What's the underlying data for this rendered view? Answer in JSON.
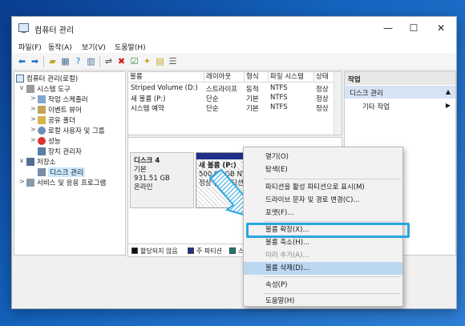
{
  "window": {
    "title": "컴퓨터 관리",
    "buttons": {
      "minimize": "—",
      "maximize": "☐",
      "close": "✕"
    }
  },
  "menu": [
    "파일(F)",
    "동작(A)",
    "보기(V)",
    "도움말(H)"
  ],
  "toolbar_icons": [
    "back-arrow-icon",
    "forward-arrow-icon",
    "up-folder-icon",
    "properties-icon",
    "help-icon",
    "show-hide-icon",
    "connect-icon",
    "delete-icon",
    "check-icon",
    "new-icon",
    "folder-icon",
    "list-icon"
  ],
  "tree": [
    {
      "label": "컴퓨터 관리(로컬)",
      "exp": "",
      "icon": "computer-icon"
    },
    {
      "label": "시스템 도구",
      "exp": "∨",
      "icon": "tools-icon"
    },
    {
      "label": "작업 스케줄러",
      "exp": ">",
      "icon": "scheduler-icon"
    },
    {
      "label": "이벤트 뷰어",
      "exp": ">",
      "icon": "event-viewer-icon"
    },
    {
      "label": "공유 폴더",
      "exp": ">",
      "icon": "shared-folder-icon"
    },
    {
      "label": "로컬 사용자 및 그룹",
      "exp": ">",
      "icon": "users-icon"
    },
    {
      "label": "성능",
      "exp": ">",
      "icon": "performance-icon"
    },
    {
      "label": "장치 관리자",
      "exp": "",
      "icon": "device-manager-icon"
    },
    {
      "label": "저장소",
      "exp": "∨",
      "icon": "storage-icon"
    },
    {
      "label": "디스크 관리",
      "exp": "",
      "icon": "disk-management-icon"
    },
    {
      "label": "서비스 및 응용 프로그램",
      "exp": ">",
      "icon": "services-icon"
    }
  ],
  "volume_columns": [
    "볼륨",
    "레이아웃",
    "형식",
    "파일 시스템",
    "상태"
  ],
  "volumes": [
    {
      "name": "Striped Volume (D:)",
      "layout": "스트라이프",
      "type": "동적",
      "fs": "NTFS",
      "status": "정상"
    },
    {
      "name": "새 볼륨 (P:)",
      "layout": "단순",
      "type": "기본",
      "fs": "NTFS",
      "status": "정상"
    },
    {
      "name": "시스템 예약",
      "layout": "단순",
      "type": "기본",
      "fs": "NTFS",
      "status": "정상"
    }
  ],
  "disk": {
    "name": "디스크 4",
    "type": "기본",
    "size": "931.51 GB",
    "state": "온라인",
    "partition": {
      "name": "새 볼륨 (P:)",
      "size": "500.00 GB NTF",
      "status": "정상 (주 파티션"
    }
  },
  "legend": [
    "할당되지 않음",
    "주 파티션",
    "스"
  ],
  "actions": {
    "header": "작업",
    "selected": "디스크 관리",
    "more": "기타 작업"
  },
  "context_menu": [
    {
      "label": "열기(O)",
      "disabled": false
    },
    {
      "label": "탐색(E)",
      "disabled": false
    },
    {
      "label": "파티션을 활성 파티션으로 표시(M)",
      "disabled": false
    },
    {
      "label": "드라이브 문자 및 경로 변경(C)...",
      "disabled": false
    },
    {
      "label": "포맷(F)...",
      "disabled": false
    },
    {
      "label": "볼륨 확장(X)...",
      "disabled": false
    },
    {
      "label": "볼륨 축소(H)...",
      "disabled": false
    },
    {
      "label": "미러 추가(A)...",
      "disabled": true
    },
    {
      "label": "볼륨 삭제(D)...",
      "disabled": false
    },
    {
      "label": "속성(P)",
      "disabled": false
    },
    {
      "label": "도움말(H)",
      "disabled": false
    }
  ],
  "colors": {
    "accent_highlight": "#29a6e0",
    "primary_partition": "#1f2f8a",
    "unallocated": "#111111",
    "context_hover": "#bcd7f2"
  }
}
